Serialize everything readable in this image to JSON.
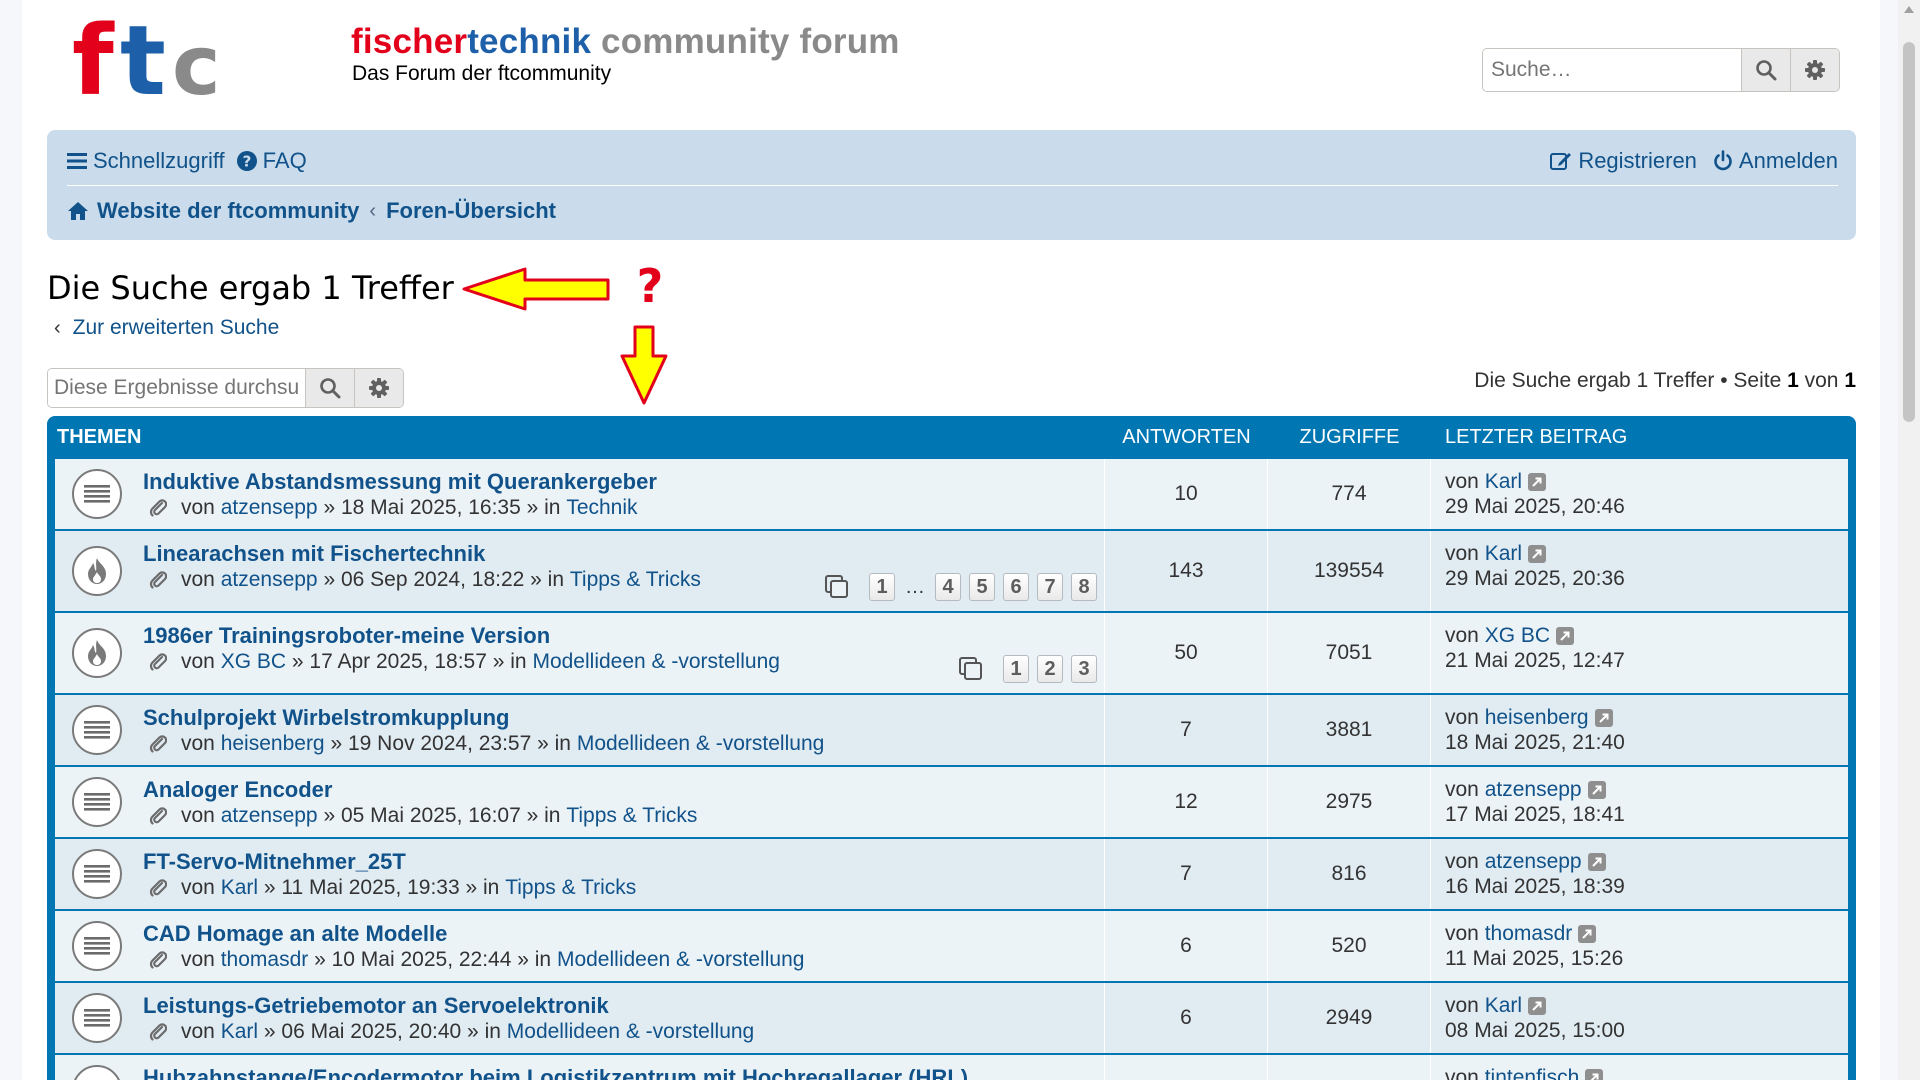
{
  "header": {
    "logo_text": "ftc",
    "title_part1": "fischer",
    "title_part2": "technik",
    "title_part3": " community forum",
    "description": "Das Forum der ftcommunity",
    "search_placeholder": "Suche…",
    "search_icon": "search-icon",
    "settings_icon": "gear-icon"
  },
  "nav": {
    "quick_access": "Schnellzugriff",
    "faq": "FAQ",
    "register": "Registrieren",
    "login": "Anmelden",
    "breadcrumb_home": "Website der ftcommunity",
    "breadcrumb_index": "Foren-Übersicht"
  },
  "search": {
    "result_title": "Die Suche ergab 1 Treffer",
    "advanced_link": "Zur erweiterten Suche",
    "filter_placeholder": "Diese Ergebnisse durchsuchen",
    "pagination_prefix": "Die Suche ergab 1 Treffer • Seite ",
    "page_current": "1",
    "pagination_of": " von ",
    "page_total": "1"
  },
  "annotation": {
    "question_mark": "?",
    "arrow_color": "#ffff00",
    "arrow_outline": "#e3001b"
  },
  "table": {
    "headers": {
      "topics": "Themen",
      "replies": "Antworten",
      "views": "Zugriffe",
      "last_post": "Letzter Beitrag"
    },
    "rows": [
      {
        "icon": "topic-read-icon",
        "title": "Induktive Abstandsmessung mit Querankergeber",
        "by": "von",
        "author": "atzensepp",
        "date": "» 18 Mai 2025, 16:35 » in",
        "forum": "Technik",
        "pages": [],
        "replies": "10",
        "views": "774",
        "last_by": "von",
        "last_author": "Karl",
        "last_date": "29 Mai 2025, 20:46"
      },
      {
        "icon": "topic-hot-icon",
        "title": "Linearachsen mit Fischertechnik",
        "by": "von",
        "author": "atzensepp",
        "date": "» 06 Sep 2024, 18:22 » in",
        "forum": "Tipps & Tricks",
        "pages": [
          "1",
          "…",
          "4",
          "5",
          "6",
          "7",
          "8"
        ],
        "replies": "143",
        "views": "139554",
        "last_by": "von",
        "last_author": "Karl",
        "last_date": "29 Mai 2025, 20:36"
      },
      {
        "icon": "topic-hot-icon",
        "title": "1986er Trainingsroboter-meine Version",
        "by": "von",
        "author": "XG BC",
        "date": "» 17 Apr 2025, 18:57 » in",
        "forum": "Modellideen & -vorstellung",
        "pages": [
          "1",
          "2",
          "3"
        ],
        "replies": "50",
        "views": "7051",
        "last_by": "von",
        "last_author": "XG BC",
        "last_date": "21 Mai 2025, 12:47"
      },
      {
        "icon": "topic-read-icon",
        "title": "Schulprojekt Wirbelstromkupplung",
        "by": "von",
        "author": "heisenberg",
        "date": "» 19 Nov 2024, 23:57 » in",
        "forum": "Modellideen & -vorstellung",
        "pages": [],
        "replies": "7",
        "views": "3881",
        "last_by": "von",
        "last_author": "heisenberg",
        "last_date": "18 Mai 2025, 21:40"
      },
      {
        "icon": "topic-read-icon",
        "title": "Analoger Encoder",
        "by": "von",
        "author": "atzensepp",
        "date": "» 05 Mai 2025, 16:07 » in",
        "forum": "Tipps & Tricks",
        "pages": [],
        "replies": "12",
        "views": "2975",
        "last_by": "von",
        "last_author": "atzensepp",
        "last_date": "17 Mai 2025, 18:41"
      },
      {
        "icon": "topic-read-icon",
        "title": "FT-Servo-Mitnehmer_25T",
        "by": "von",
        "author": "Karl",
        "date": "» 11 Mai 2025, 19:33 » in",
        "forum": "Tipps & Tricks",
        "pages": [],
        "replies": "7",
        "views": "816",
        "last_by": "von",
        "last_author": "atzensepp",
        "last_date": "16 Mai 2025, 18:39"
      },
      {
        "icon": "topic-read-icon",
        "title": "CAD Homage an alte Modelle",
        "by": "von",
        "author": "thomasdr",
        "date": "» 10 Mai 2025, 22:44 » in",
        "forum": "Modellideen & -vorstellung",
        "pages": [],
        "replies": "6",
        "views": "520",
        "last_by": "von",
        "last_author": "thomasdr",
        "last_date": "11 Mai 2025, 15:26"
      },
      {
        "icon": "topic-read-icon",
        "title": "Leistungs-Getriebemotor an Servoelektronik",
        "by": "von",
        "author": "Karl",
        "date": "» 06 Mai 2025, 20:40 » in",
        "forum": "Modellideen & -vorstellung",
        "pages": [],
        "replies": "6",
        "views": "2949",
        "last_by": "von",
        "last_author": "Karl",
        "last_date": "08 Mai 2025, 15:00"
      },
      {
        "icon": "topic-read-icon",
        "title": "Hubzahnstange/Encodermotor beim Logistikzentrum mit Hochregallager (HRL)",
        "by": "",
        "author": "",
        "date": "",
        "forum": "",
        "pages": [],
        "replies": "",
        "views": "",
        "last_by": "von",
        "last_author": "tintenfisch",
        "last_date": ""
      }
    ]
  }
}
